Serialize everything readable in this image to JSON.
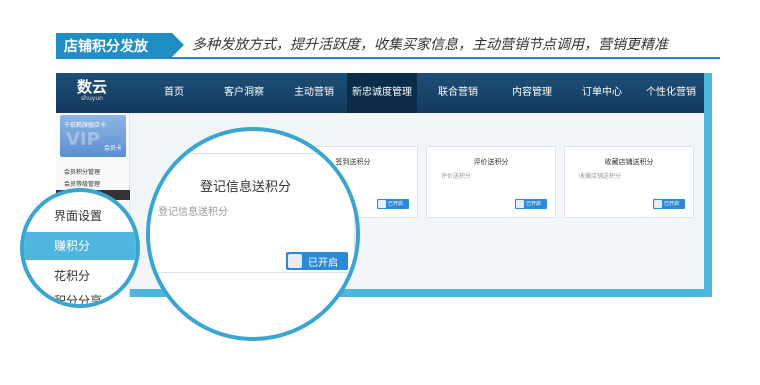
{
  "header": {
    "tab_title": "店铺积分发放",
    "subtitle": "多种发放方式，提升活跃度，收集买家信息，主动营销节点调用，营销更精准"
  },
  "app": {
    "logo": {
      "name": "数云",
      "sub": "shuyun"
    },
    "nav": [
      {
        "label": "首页"
      },
      {
        "label": "客户洞察"
      },
      {
        "label": "主动营销"
      },
      {
        "label": "新忠诚度管理",
        "active": true
      },
      {
        "label": "联合营销"
      },
      {
        "label": "内容管理"
      },
      {
        "label": "订单中心"
      },
      {
        "label": "个性化营销"
      }
    ],
    "sidebar": {
      "vip_text": "千纸鹤旗舰店卡",
      "vip_label": "会员卡",
      "vip_big": "VIP",
      "items": [
        {
          "label": "会员积分管理"
        },
        {
          "label": "会员等级管理"
        }
      ]
    },
    "cards": [
      {
        "title": "签到送积分",
        "sub": "",
        "toggle": "已开启"
      },
      {
        "title": "评价送积分",
        "sub": "评价送积分",
        "toggle": "已开启"
      },
      {
        "title": "收藏店铺送积分",
        "sub": "收藏店铺送积分",
        "toggle": "已开启"
      }
    ]
  },
  "magnifier_big": {
    "title": "登记信息送积分",
    "sub": "登记信息送积分",
    "toggle": "已开启"
  },
  "magnifier_small": {
    "items": [
      {
        "label": "界面设置"
      },
      {
        "label": "赚积分",
        "active": true
      },
      {
        "label": "花积分"
      }
    ],
    "cut_label": "积分分享"
  },
  "colors": {
    "accent": "#1f8fc3",
    "nav_bg": "#123a5d",
    "highlight": "#4fb6e0",
    "toggle_on": "#2a8ad6"
  }
}
